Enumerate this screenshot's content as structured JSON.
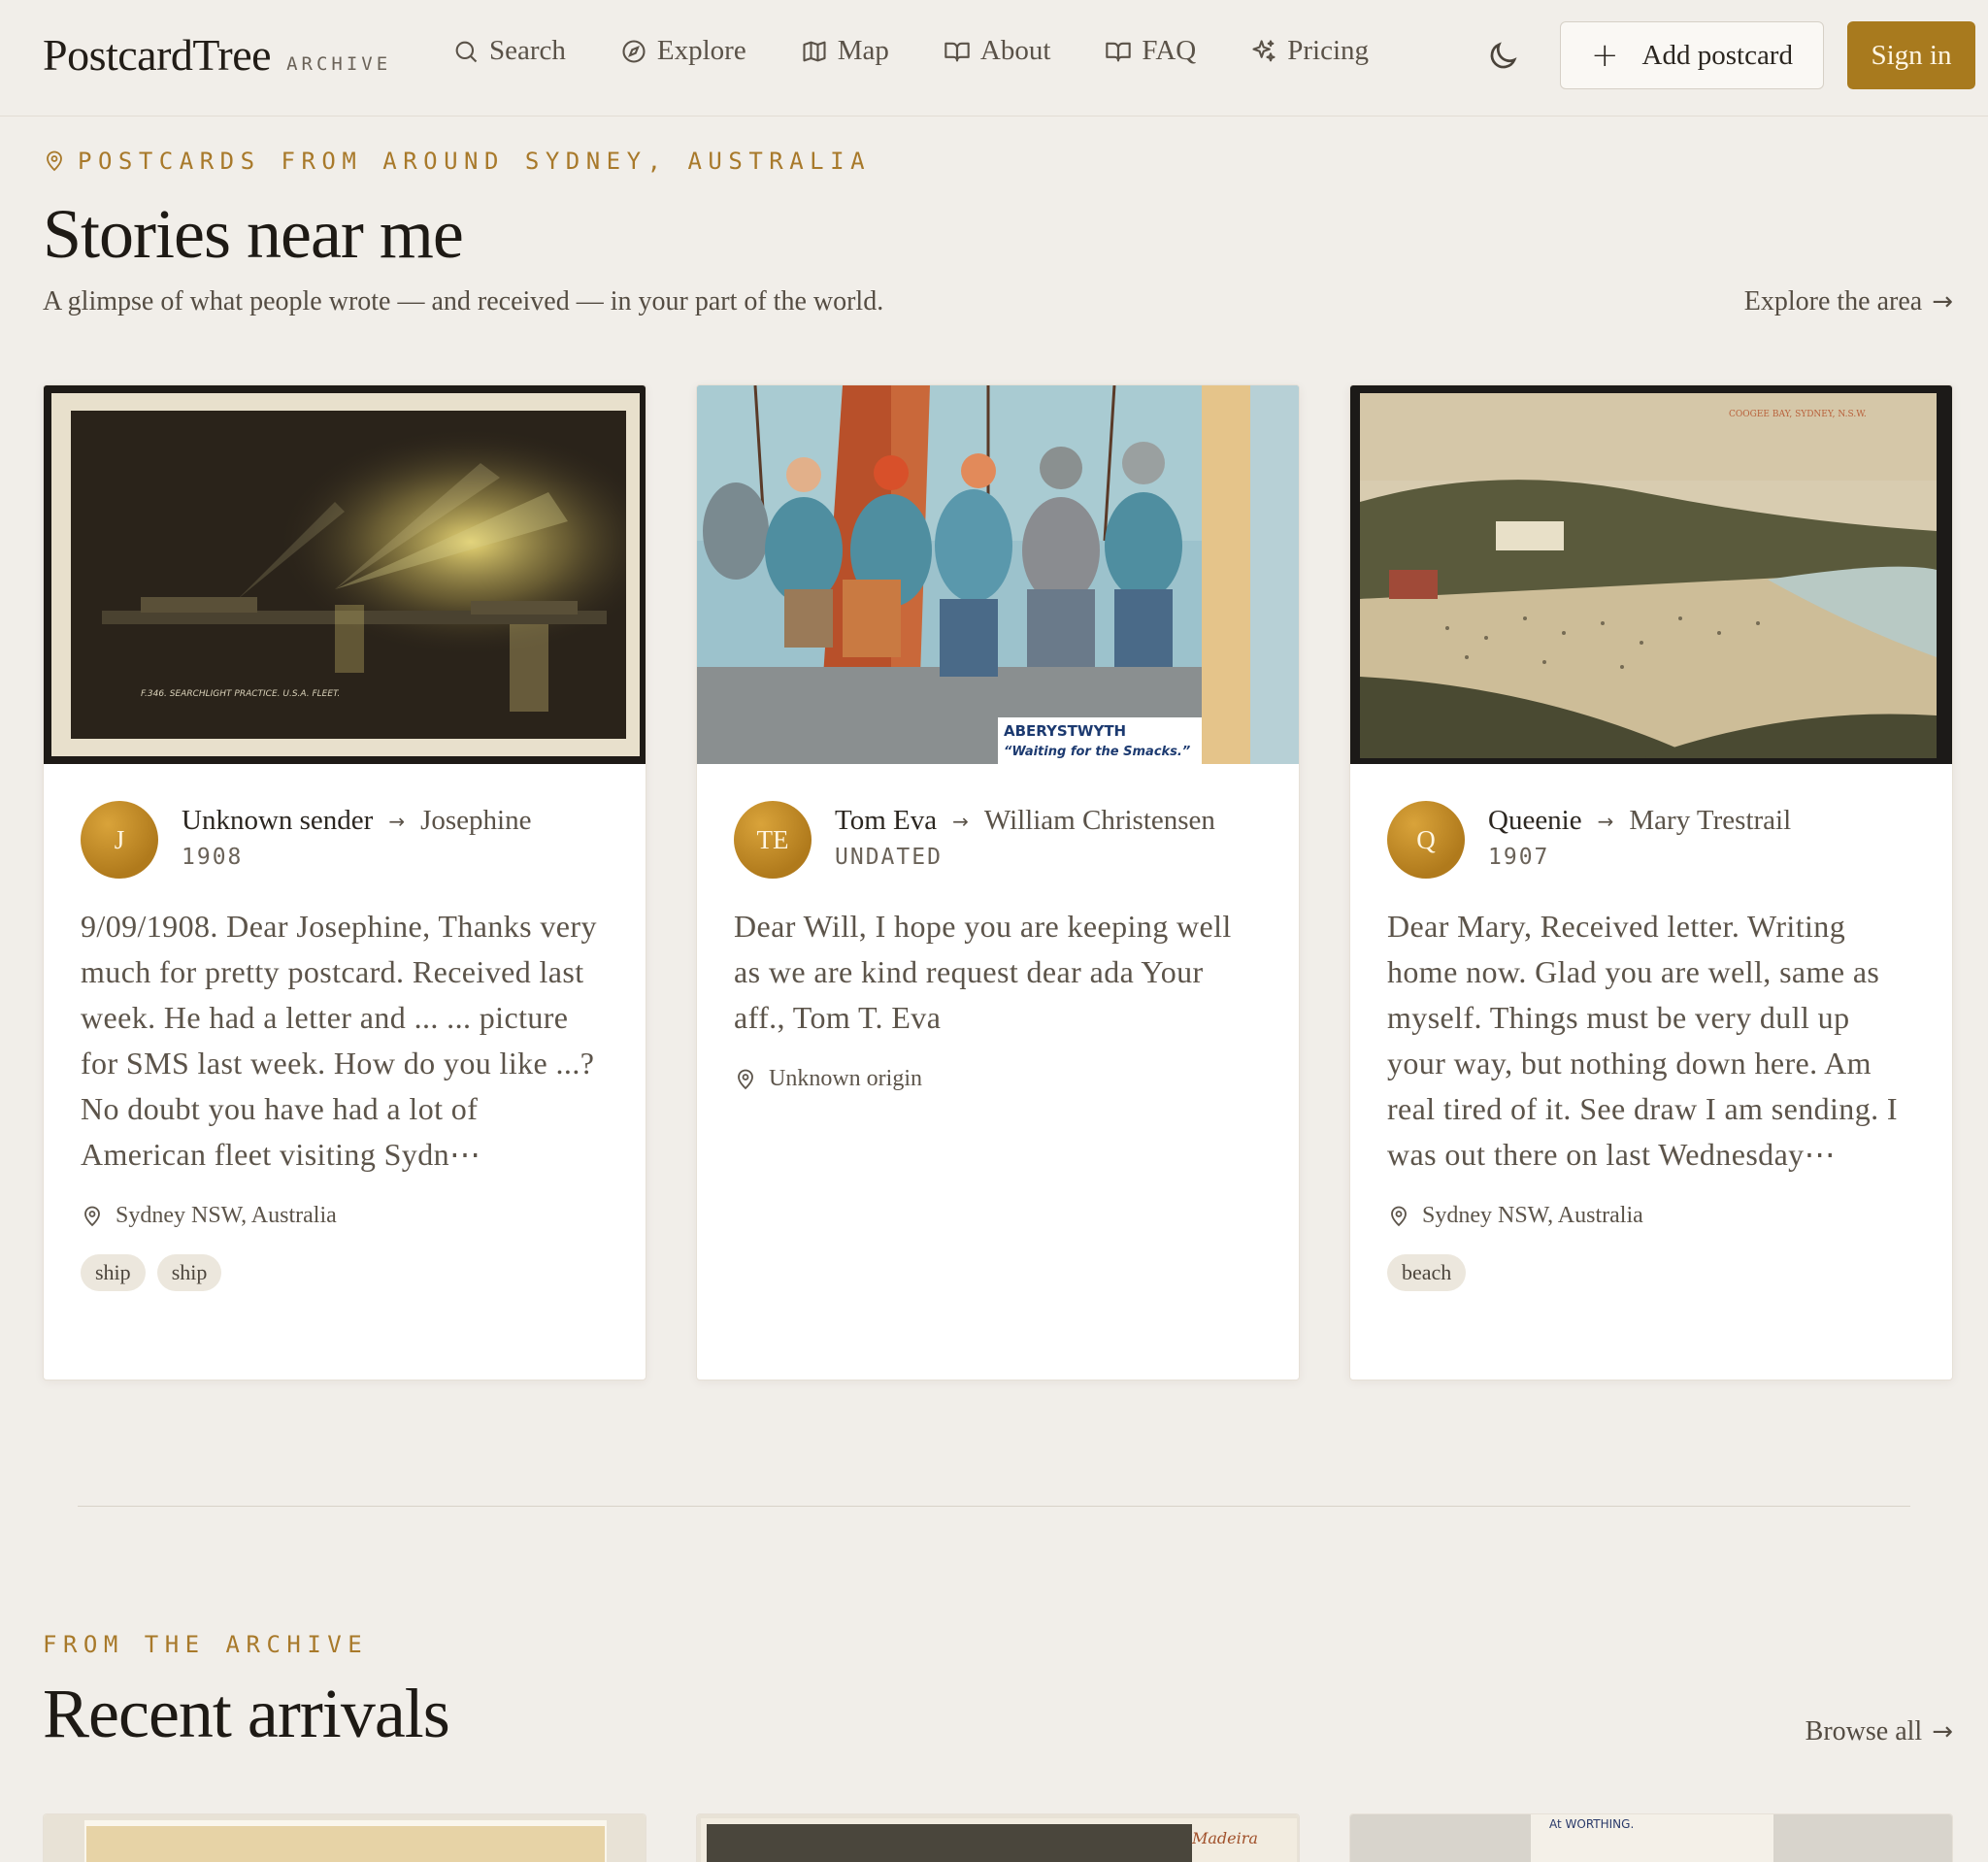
{
  "nav": {
    "brand": "PostcardTree",
    "brand_sub": "ARCHIVE",
    "links": [
      {
        "label": "Search",
        "icon": "search-icon"
      },
      {
        "label": "Explore",
        "icon": "compass-icon"
      },
      {
        "label": "Map",
        "icon": "map-icon"
      },
      {
        "label": "About",
        "icon": "book-open-icon"
      },
      {
        "label": "FAQ",
        "icon": "book-icon"
      },
      {
        "label": "Pricing",
        "icon": "sparkle-icon"
      }
    ],
    "add_label": "Add postcard",
    "signin_label": "Sign in"
  },
  "hero": {
    "eyebrow": "POSTCARDS FROM AROUND SYDNEY, AUSTRALIA",
    "title": "Stories near me",
    "lede": "A glimpse of what people wrote — and received — in your part of the world.",
    "explore_label": "Explore the area"
  },
  "cards": [
    {
      "avatar": "J",
      "sender": "Unknown sender",
      "recipient": "Josephine",
      "year": "1908",
      "message": "9/09/1908. Dear Josephine, Thanks very much for pretty postcard. Received last week. He had a letter and ... ... picture for SMS last week. How do you like ...? No doubt you have had a lot of American fleet visiting Sydn⋯",
      "location": "Sydney NSW, Australia",
      "tags": [
        "ship",
        "ship"
      ],
      "image_caption": "F.346. SEARCHLIGHT PRACTICE. U.S.A. FLEET."
    },
    {
      "avatar": "TE",
      "sender": "Tom Eva",
      "recipient": "William Christensen",
      "year": "UNDATED",
      "message": "Dear Will, I hope you are keeping well as we are kind request dear ada Your aff., Tom T. Eva",
      "location": "Unknown origin",
      "tags": [],
      "image_caption_1": "ABERYSTWYTH",
      "image_caption_2": "“Waiting for the Smacks.”"
    },
    {
      "avatar": "Q",
      "sender": "Queenie",
      "recipient": "Mary Trestrail",
      "year": "1907",
      "message": "Dear Mary, Received letter. Writing home now. Glad you are well, same as myself. Things must be very dull up your way, but nothing down here. Am real tired of it. See draw I am sending. I was out there on last Wednesday⋯",
      "location": "Sydney NSW, Australia",
      "tags": [
        "beach"
      ],
      "image_caption": "COOGEE BAY, SYDNEY, N.S.W."
    }
  ],
  "recent": {
    "eyebrow": "FROM THE ARCHIVE",
    "title": "Recent arrivals",
    "browse_label": "Browse all",
    "partial_text_2": "Madeira",
    "partial_text_3": "At WORTHING."
  },
  "colors": {
    "background": "#f1eee9",
    "accent": "#a87a1e",
    "eyebrow": "#a8792a"
  }
}
